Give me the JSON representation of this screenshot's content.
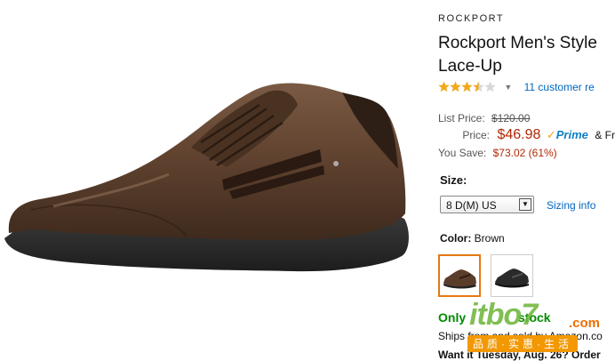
{
  "product": {
    "brand": "ROCKPORT",
    "title": "Rockport Men's Style Lace-Up",
    "rating": 3.5,
    "rating_max": 5,
    "reviews_link": "11 customer re",
    "colors": {
      "star_fill": "#f0a91d",
      "star_empty": "#d8d8d8",
      "price": "#b12704",
      "link": "#0066c0",
      "stock": "#008a00",
      "swatch_selected": "#e47911"
    }
  },
  "pricing": {
    "list_label": "List Price:",
    "list_value": "$120.00",
    "price_label": "Price:",
    "price_value": "$46.98",
    "prime_label": "Prime",
    "prime_after": "& Fr",
    "save_label": "You Save:",
    "save_value": "$73.02 (61%)"
  },
  "options": {
    "size_label": "Size:",
    "size_selected": "8 D(M) US",
    "sizing_info": "Sizing info",
    "color_label": "Color:",
    "color_selected": "Brown",
    "swatches": [
      {
        "name": "Brown"
      },
      {
        "name": "Black"
      }
    ]
  },
  "availability": {
    "stock": "Only",
    "stock_tail": "stock",
    "ships": "Ships from and sold by Amazon.co",
    "delivery": "Want it Tuesday, Aug. 26? Order"
  },
  "watermark": {
    "logo_main": "itbo7",
    "logo_com": ".com",
    "slogan": "品质·实惠·生活"
  },
  "icons": {
    "star": "star-icon",
    "chevron": "chevron-down-icon",
    "select_arrow": "dropdown-arrow-icon",
    "prime_check": "prime-check-icon"
  }
}
